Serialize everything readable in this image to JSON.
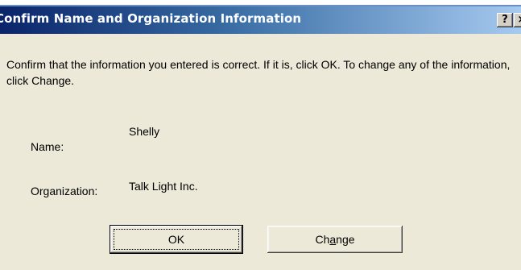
{
  "window": {
    "title": "Confirm Name and Organization Information",
    "help_button": "?",
    "close_button": "×"
  },
  "message": "Confirm that the information you entered is correct. If it is, click OK. To change any of the information, click Change.",
  "fields": {
    "name_label": "Name:",
    "name_value": "Shelly",
    "organization_label": "Organization:",
    "organization_value": "Talk Light Inc."
  },
  "buttons": {
    "ok_label": "OK",
    "change_prefix": "Ch",
    "change_mnemonic": "a",
    "change_suffix": "nge"
  },
  "colors": {
    "titlebar_start": "#0a246a",
    "titlebar_end": "#a6caf0",
    "dialog_background": "#ece9d8"
  }
}
